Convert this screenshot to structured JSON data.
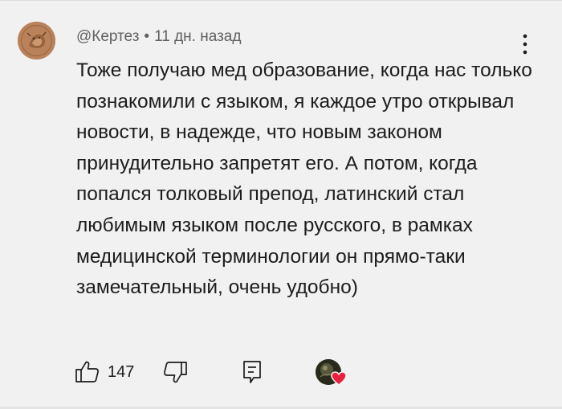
{
  "comment": {
    "author": "@Кертез",
    "separator": "•",
    "timestamp": "11 дн. назад",
    "text": "Тоже получаю мед образование, когда нас только познакомили с языком, я каждое утро открывал новости, в надежде, что новым законом принудительно запретят его. А потом, когда попался толковый препод, латинский стал любимым языком после русского, в рамках медицинской терминологии он прямо-таки замечательный, очень удобно)",
    "likes": "147"
  },
  "icons": {
    "menu": "more-vertical-icon",
    "like": "thumb-up-icon",
    "dislike": "thumb-down-icon",
    "reply": "reply-icon",
    "heart": "heart-icon"
  },
  "colors": {
    "background": "#f1f1f1",
    "text": "#1c1c1c",
    "meta": "#606060",
    "heart": "#e8203f"
  }
}
